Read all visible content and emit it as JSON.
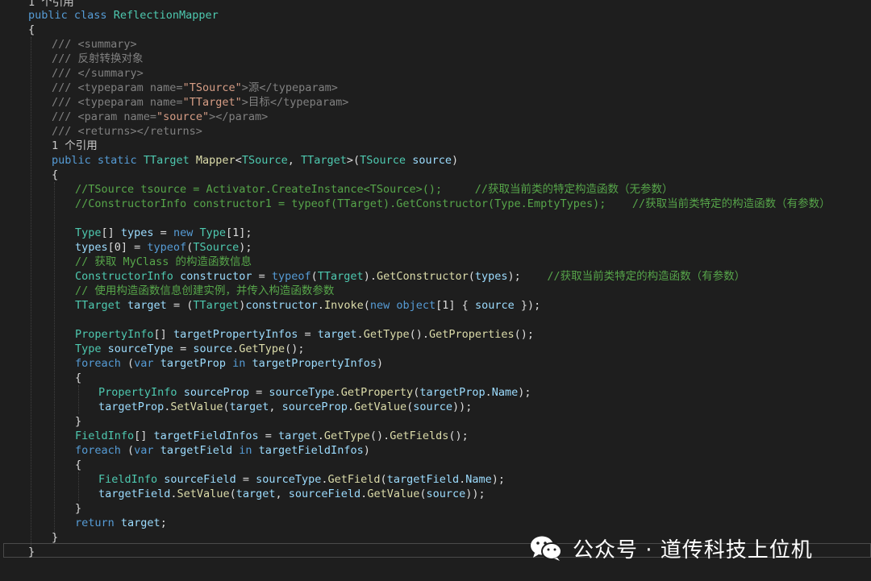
{
  "code": {
    "lines": [
      {
        "t": "1 个引用"
      },
      {
        "t": "public class ReflectionMapper"
      },
      {
        "t": "{"
      },
      {
        "t": "/// <summary>"
      },
      {
        "t": "/// 反射转换对象"
      },
      {
        "t": "/// </summary>"
      },
      {
        "t": "/// <typeparam name=\"TSource\">源</typeparam>"
      },
      {
        "t": "/// <typeparam name=\"TTarget\">目标</typeparam>"
      },
      {
        "t": "/// <param name=\"source\"></param>"
      },
      {
        "t": "/// <returns></returns>"
      },
      {
        "t": "1 个引用"
      },
      {
        "t": "public static TTarget Mapper<TSource, TTarget>(TSource source)"
      },
      {
        "t": "{"
      },
      {
        "t": "//TSource tsource = Activator.CreateInstance<TSource>();     //获取当前类的特定构造函数（无参数）"
      },
      {
        "t": "//ConstructorInfo constructor1 = typeof(TTarget).GetConstructor(Type.EmptyTypes);    //获取当前类特定的构造函数（有参数）"
      },
      {
        "t": ""
      },
      {
        "t": "Type[] types = new Type[1];"
      },
      {
        "t": "types[0] = typeof(TSource);"
      },
      {
        "t": "// 获取 MyClass 的构造函数信息"
      },
      {
        "t": "ConstructorInfo constructor = typeof(TTarget).GetConstructor(types);    //获取当前类特定的构造函数（有参数）"
      },
      {
        "t": "// 使用构造函数信息创建实例，并传入构造函数参数"
      },
      {
        "t": "TTarget target = (TTarget)constructor.Invoke(new object[1] { source });"
      },
      {
        "t": ""
      },
      {
        "t": "PropertyInfo[] targetPropertyInfos = target.GetType().GetProperties();"
      },
      {
        "t": "Type sourceType = source.GetType();"
      },
      {
        "t": "foreach (var targetProp in targetPropertyInfos)"
      },
      {
        "t": "{"
      },
      {
        "t": "PropertyInfo sourceProp = sourceType.GetProperty(targetProp.Name);"
      },
      {
        "t": "targetProp.SetValue(target, sourceProp.GetValue(source));"
      },
      {
        "t": "}"
      },
      {
        "t": "FieldInfo[] targetFieldInfos = target.GetType().GetFields();"
      },
      {
        "t": "foreach (var targetField in targetFieldInfos)"
      },
      {
        "t": "{"
      },
      {
        "t": "FieldInfo sourceField = sourceType.GetField(targetField.Name);"
      },
      {
        "t": "targetField.SetValue(target, sourceField.GetValue(source));"
      },
      {
        "t": "}"
      },
      {
        "t": "return target;"
      },
      {
        "t": "}"
      },
      {
        "t": "}"
      }
    ]
  },
  "watermark": {
    "text": "公众号 · 道传科技上位机",
    "icon": "wechat-icon"
  },
  "colors": {
    "background": "#1e1e1e",
    "keyword": "#569cd6",
    "type": "#4ec9b0",
    "comment": "#57a64a"
  }
}
